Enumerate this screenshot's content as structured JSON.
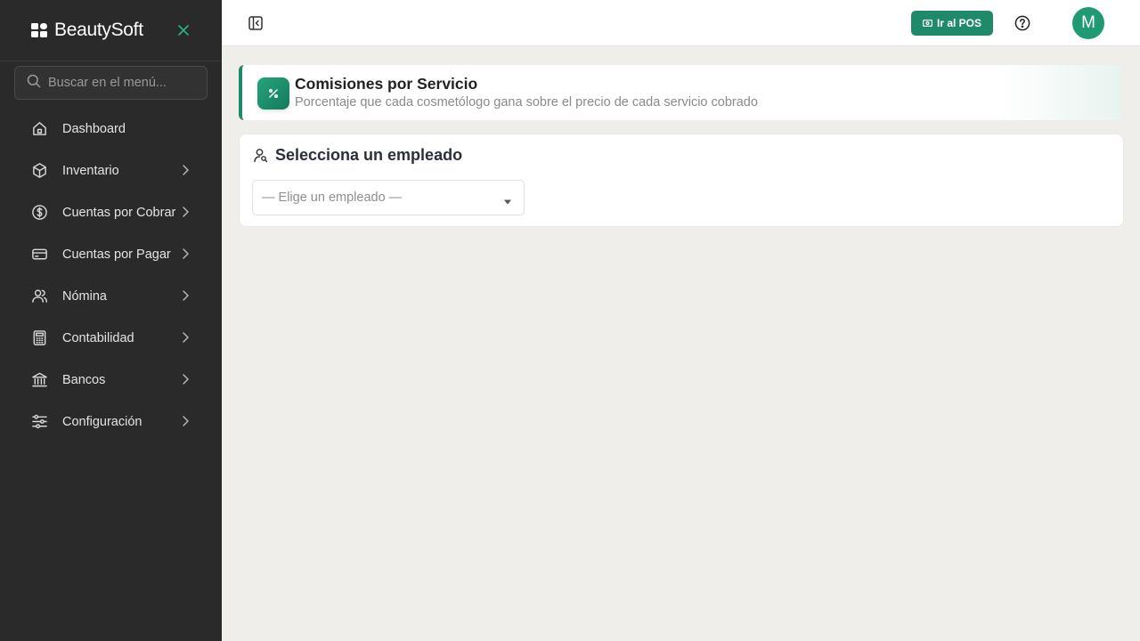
{
  "brand": {
    "name": "BeautySoft"
  },
  "search": {
    "placeholder": "Buscar en el menú..."
  },
  "sidebar": {
    "items": [
      {
        "label": "Dashboard",
        "icon": "home-icon",
        "has_children": false
      },
      {
        "label": "Inventario",
        "icon": "box-icon",
        "has_children": true
      },
      {
        "label": "Cuentas por Cobrar",
        "icon": "dollar-circle-icon",
        "has_children": true
      },
      {
        "label": "Cuentas por Pagar",
        "icon": "credit-card-icon",
        "has_children": true
      },
      {
        "label": "Nómina",
        "icon": "users-icon",
        "has_children": true
      },
      {
        "label": "Contabilidad",
        "icon": "calculator-icon",
        "has_children": true
      },
      {
        "label": "Bancos",
        "icon": "bank-icon",
        "has_children": true
      },
      {
        "label": "Configuración",
        "icon": "sliders-icon",
        "has_children": true
      }
    ]
  },
  "topbar": {
    "pos_label": "Ir al POS",
    "avatar_initial": "M"
  },
  "header": {
    "title": "Comisiones por Servicio",
    "subtitle": "Porcentaje que cada cosmetólogo gana sobre el precio de cada servicio cobrado",
    "icon": "percent-icon"
  },
  "employee_select": {
    "title": "Selecciona un empleado",
    "selected": "— Elige un empleado —"
  },
  "colors": {
    "accent": "#1f8a6a",
    "sidebar_bg": "#2a2a2a",
    "page_bg": "#efeeeb"
  }
}
